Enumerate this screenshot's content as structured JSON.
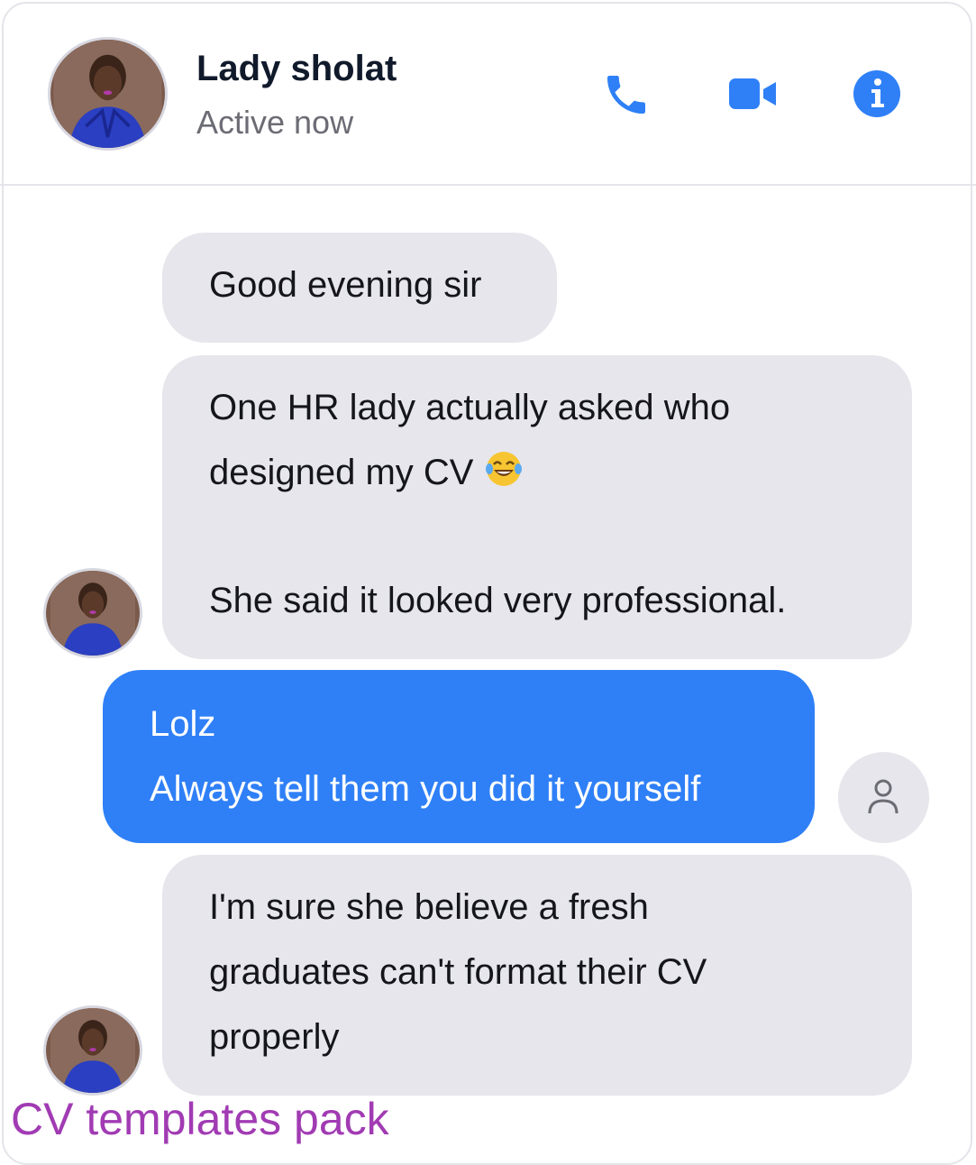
{
  "contact": {
    "name": "Lady sholat",
    "status": "Active now"
  },
  "header_actions": {
    "call_icon": "phone-icon",
    "video_icon": "video-camera-icon",
    "info_icon": "info-icon",
    "accent_color": "#2f80f7"
  },
  "messages": [
    {
      "from": "contact",
      "lines": [
        "Good evening sir"
      ]
    },
    {
      "from": "contact",
      "lines": [
        "One HR lady actually asked who",
        "designed my CV",
        "",
        "She said it looked very professional."
      ],
      "emoji": "tears-of-joy-emoji"
    },
    {
      "from": "me",
      "lines": [
        "Lolz",
        "Always tell them you did it yourself"
      ]
    },
    {
      "from": "contact",
      "lines": [
        "I'm sure she believe a fresh",
        "graduates can't format their CV",
        "properly"
      ]
    }
  ],
  "colors": {
    "incoming_bubble": "#e6e6ec",
    "outgoing_bubble": "#2f80f7",
    "watermark": "#a13bb3"
  },
  "watermark": "CV templates pack"
}
